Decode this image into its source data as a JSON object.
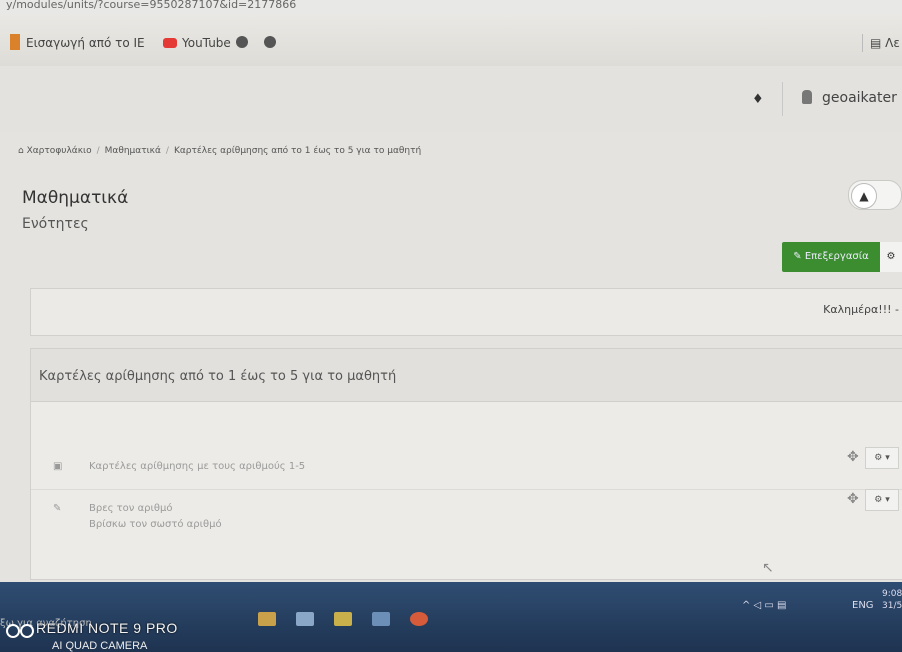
{
  "browser": {
    "url": "y/modules/units/?course=9550287107&id=2177866",
    "bookmarks": [
      "Εισαγωγή από το IE",
      "YouTube"
    ],
    "reader_label": "Λε"
  },
  "navbar": {
    "home_icon": "home-icon",
    "username": "geoaikater"
  },
  "breadcrumb": {
    "items": [
      "Χαρτοφυλάκιο",
      "Μαθηματικά",
      "Καρτέλες αρίθμησης από το 1 έως το 5 για το μαθητή"
    ]
  },
  "page": {
    "title": "Μαθηματικά",
    "subtitle": "Ενότητες",
    "edit_label": "Επεξεργασία",
    "gear_label": "⚙"
  },
  "sections": {
    "greeting": "Καλημέρα!!! -",
    "card_title": "Καρτέλες αρίθμησης από το 1 έως το 5 για το μαθητή",
    "activities": [
      {
        "label": "Καρτέλες αρίθμησης με τους αριθμούς 1-5",
        "sublabel": ""
      },
      {
        "label": "Βρες τον αριθμό",
        "sublabel": "Βρίσκω τον σωστό αριθμό"
      }
    ],
    "menu_label": "⚙ ▾"
  },
  "taskbar": {
    "search_text": "ξω για αναζήτηση",
    "lang": "ENG",
    "time": "9:08",
    "date": "31/5/"
  },
  "watermark": {
    "line1": "REDMI NOTE 9 PRO",
    "line2": "AI QUAD CAMERA"
  }
}
